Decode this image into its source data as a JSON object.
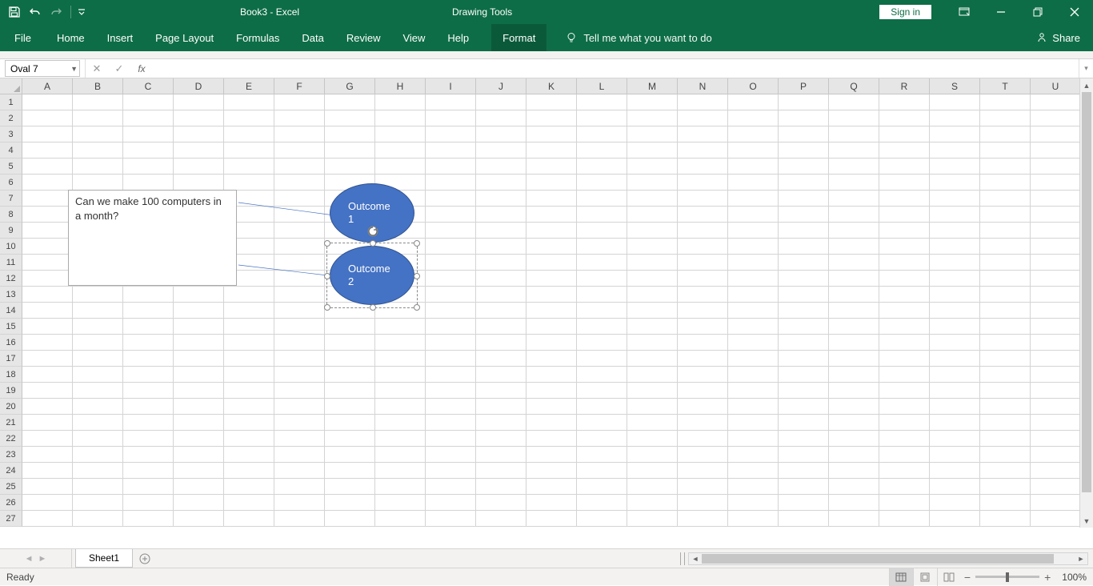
{
  "titlebar": {
    "title": "Book3 - Excel",
    "context_tool": "Drawing Tools",
    "signin": "Sign in"
  },
  "ribbon": {
    "tabs": [
      "File",
      "Home",
      "Insert",
      "Page Layout",
      "Formulas",
      "Data",
      "Review",
      "View",
      "Help"
    ],
    "context_tab": "Format",
    "tell_me": "Tell me what you want to do",
    "share": "Share"
  },
  "formula_bar": {
    "namebox": "Oval 7",
    "formula": ""
  },
  "grid": {
    "columns": [
      "A",
      "B",
      "C",
      "D",
      "E",
      "F",
      "G",
      "H",
      "I",
      "J",
      "K",
      "L",
      "M",
      "N",
      "O",
      "P",
      "Q",
      "R",
      "S",
      "T",
      "U"
    ],
    "visible_rows": 27
  },
  "shapes": {
    "textbox": {
      "text": "Can we make 100 computers in a month?"
    },
    "oval1": {
      "line1": "Outcome",
      "line2": "1"
    },
    "oval2": {
      "line1": "Outcome",
      "line2": "2",
      "selected": true
    }
  },
  "sheets": {
    "active": "Sheet1"
  },
  "statusbar": {
    "mode": "Ready",
    "zoom": "100%"
  }
}
